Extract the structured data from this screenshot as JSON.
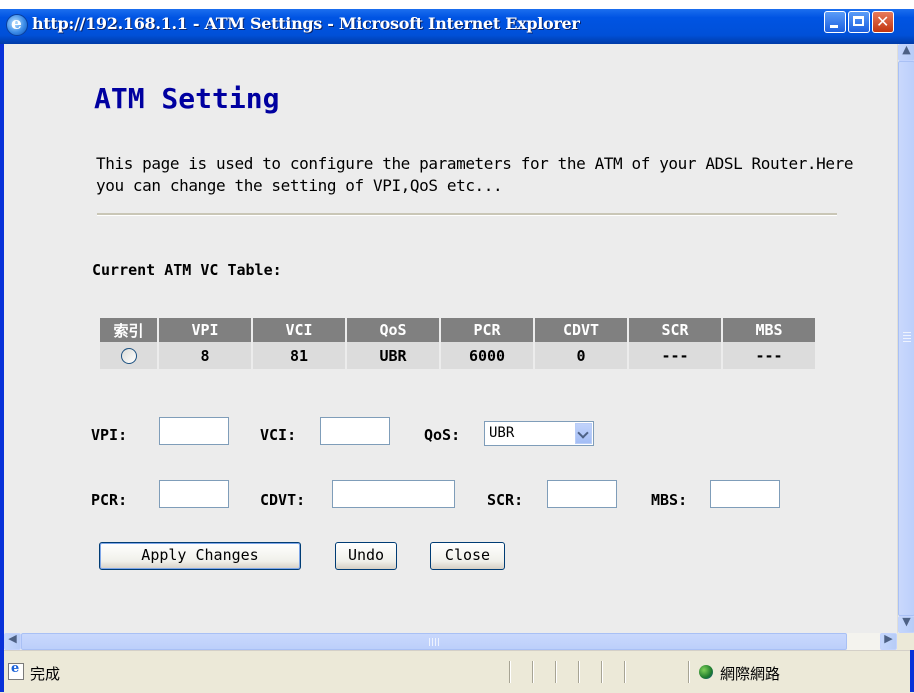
{
  "window": {
    "title": "http://192.168.1.1 - ATM Settings - Microsoft Internet Explorer"
  },
  "page": {
    "title": "ATM Setting",
    "description": "This page is used to configure the parameters for the ATM of your ADSL Router.Here you can change the setting of VPI,QoS etc...",
    "table_heading": "Current ATM VC Table:"
  },
  "vc_table": {
    "columns": [
      "索引",
      "VPI",
      "VCI",
      "QoS",
      "PCR",
      "CDVT",
      "SCR",
      "MBS"
    ],
    "rows": [
      {
        "selected": false,
        "vpi": "8",
        "vci": "81",
        "qos": "UBR",
        "pcr": "6000",
        "cdvt": "0",
        "scr": "---",
        "mbs": "---"
      }
    ]
  },
  "form": {
    "vpi_label": "VPI:",
    "vpi_value": "",
    "vci_label": "VCI:",
    "vci_value": "",
    "qos_label": "QoS:",
    "qos_value": "UBR",
    "pcr_label": "PCR:",
    "pcr_value": "",
    "cdvt_label": "CDVT:",
    "cdvt_value": "",
    "scr_label": "SCR:",
    "scr_value": "",
    "mbs_label": "MBS:",
    "mbs_value": ""
  },
  "buttons": {
    "apply": "Apply Changes",
    "undo": "Undo",
    "close": "Close"
  },
  "statusbar": {
    "status": "完成",
    "zone": "網際網路"
  },
  "icons": {
    "browser": "ie-icon",
    "status": "page-done-icon",
    "zone": "internet-globe-icon"
  }
}
